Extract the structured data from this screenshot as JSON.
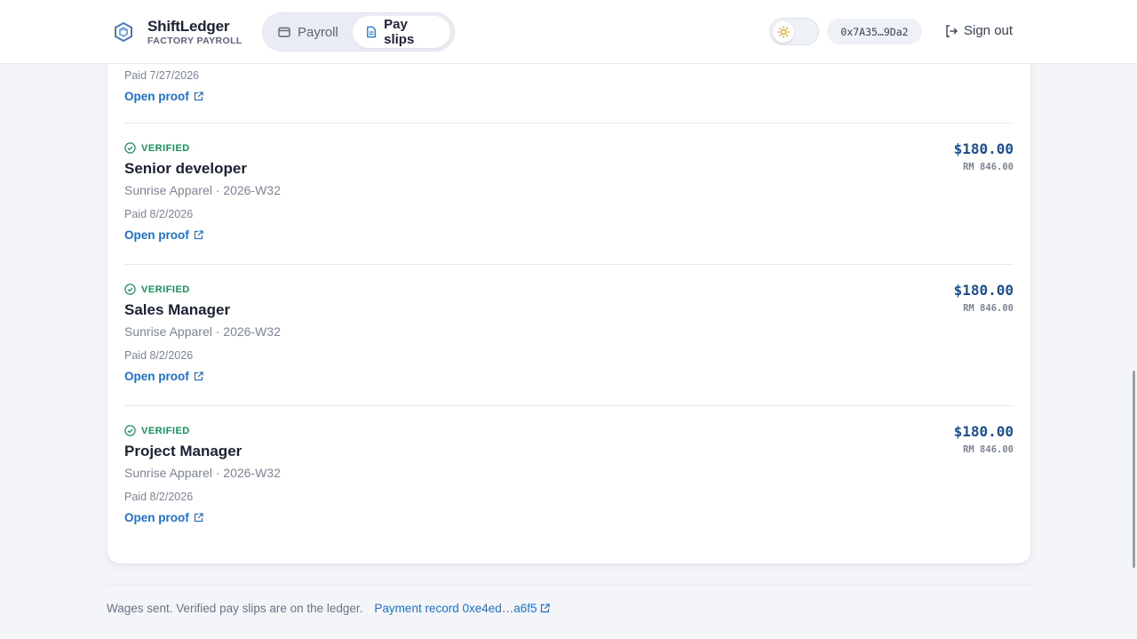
{
  "brand": {
    "name": "ShiftLedger",
    "subtitle": "FACTORY PAYROLL"
  },
  "nav": {
    "tabs": [
      {
        "label": "Payroll",
        "icon": "wallet-icon"
      },
      {
        "label": "Pay slips",
        "icon": "document-icon",
        "active": true
      }
    ]
  },
  "header": {
    "theme_toggle_icon": "sun-icon",
    "wallet_address": "0x7A35…9Da2",
    "signout_label": "Sign out"
  },
  "partial_slip": {
    "paid": "Paid 7/27/2026",
    "proof_label": "Open proof"
  },
  "slips": [
    {
      "status": "VERIFIED",
      "role": "Senior developer",
      "meta": "Sunrise Apparel · 2026-W32",
      "paid": "Paid 8/2/2026",
      "proof_label": "Open proof",
      "amount_usd": "$180.00",
      "amount_rm": "RM 846.00"
    },
    {
      "status": "VERIFIED",
      "role": "Sales Manager",
      "meta": "Sunrise Apparel · 2026-W32",
      "paid": "Paid 8/2/2026",
      "proof_label": "Open proof",
      "amount_usd": "$180.00",
      "amount_rm": "RM 846.00"
    },
    {
      "status": "VERIFIED",
      "role": "Project Manager",
      "meta": "Sunrise Apparel · 2026-W32",
      "paid": "Paid 8/2/2026",
      "proof_label": "Open proof",
      "amount_usd": "$180.00",
      "amount_rm": "RM 846.00"
    }
  ],
  "footer": {
    "message": "Wages sent. Verified pay slips are on the ledger.",
    "link_label": "Payment record 0xe4ed…a6f5"
  },
  "colors": {
    "accent": "#1e6fd0",
    "verified": "#16915a",
    "amount": "#1c4f94"
  }
}
